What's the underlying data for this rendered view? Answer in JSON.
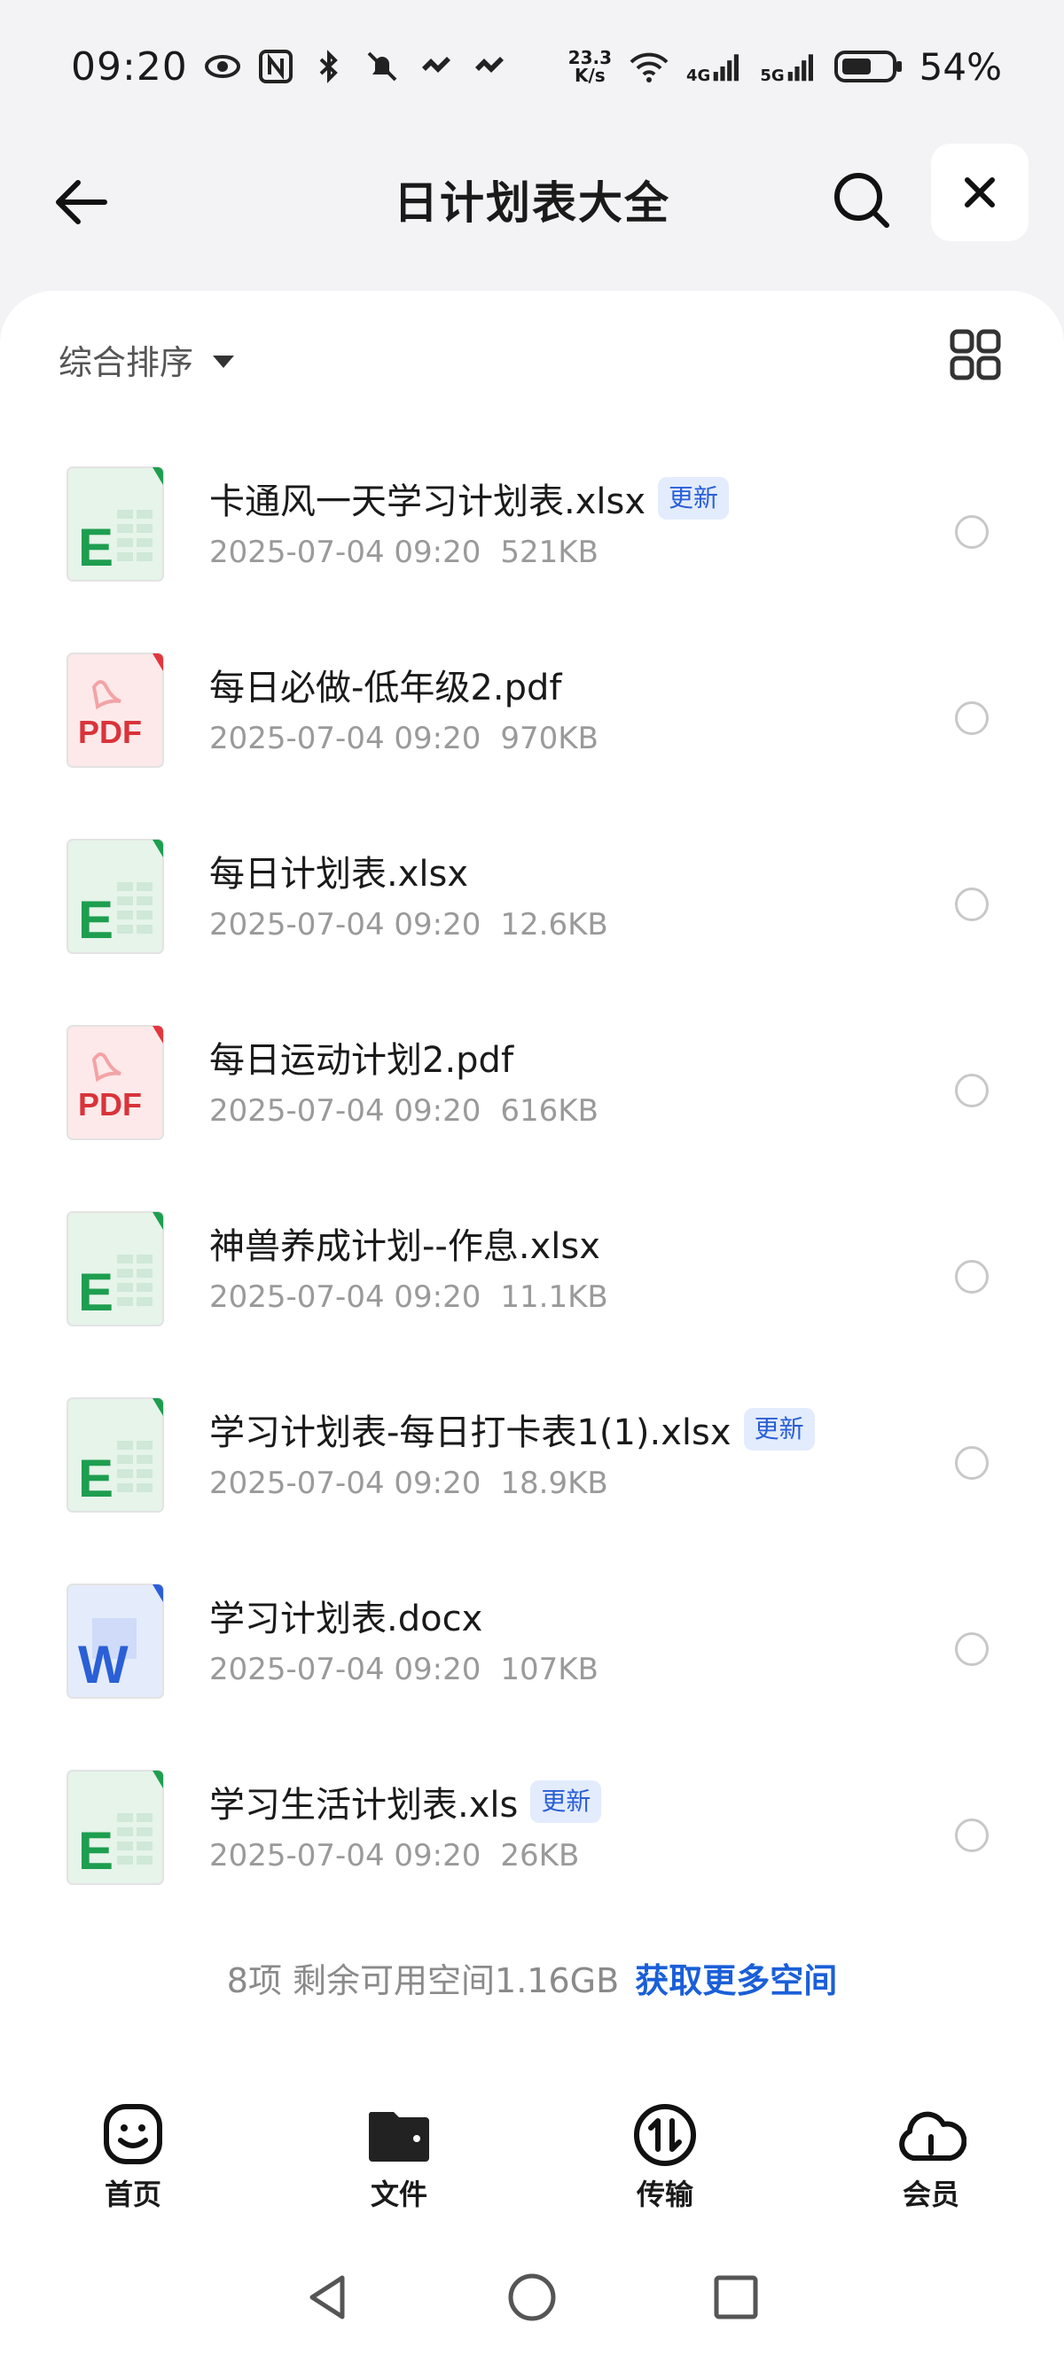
{
  "status_bar": {
    "time": "09:20",
    "net_speed_value": "23.3",
    "net_speed_unit": "K/s",
    "net_4g": "4G",
    "net_5g": "5G",
    "battery_percent": "54%"
  },
  "header": {
    "title": "日计划表大全",
    "back_icon": "arrow-left-icon",
    "search_icon": "search-icon",
    "close_icon": "close-icon"
  },
  "toolbar": {
    "sort_label": "综合排序",
    "view_icon": "grid-view-icon"
  },
  "files": [
    {
      "name": "卡通风一天学习计划表.xlsx",
      "type": "excel",
      "badge": "更新",
      "date": "2025-07-04 09:20",
      "size": "521KB"
    },
    {
      "name": "每日必做-低年级2.pdf",
      "type": "pdf",
      "badge": "",
      "date": "2025-07-04 09:20",
      "size": "970KB"
    },
    {
      "name": "每日计划表.xlsx",
      "type": "excel",
      "badge": "",
      "date": "2025-07-04 09:20",
      "size": "12.6KB"
    },
    {
      "name": "每日运动计划2.pdf",
      "type": "pdf",
      "badge": "",
      "date": "2025-07-04 09:20",
      "size": "616KB"
    },
    {
      "name": "神兽养成计划--作息.xlsx",
      "type": "excel",
      "badge": "",
      "date": "2025-07-04 09:20",
      "size": "11.1KB"
    },
    {
      "name": "学习计划表-每日打卡表1(1).xlsx",
      "type": "excel",
      "badge": "更新",
      "date": "2025-07-04 09:20",
      "size": "18.9KB"
    },
    {
      "name": "学习计划表.docx",
      "type": "word",
      "badge": "",
      "date": "2025-07-04 09:20",
      "size": "107KB"
    },
    {
      "name": "学习生活计划表.xls",
      "type": "excel",
      "badge": "更新",
      "date": "2025-07-04 09:20",
      "size": "26KB"
    }
  ],
  "file_icon_text": {
    "excel": "E",
    "pdf": "PDF",
    "word": "W"
  },
  "footer": {
    "summary": "8项 剩余可用空间1.16GB",
    "more_space_link": "获取更多空间"
  },
  "bottom_nav": [
    {
      "label": "首页",
      "icon": "home-smile-icon"
    },
    {
      "label": "文件",
      "icon": "folder-icon"
    },
    {
      "label": "传输",
      "icon": "transfer-icon"
    },
    {
      "label": "会员",
      "icon": "cloud-icon"
    }
  ],
  "colors": {
    "accent_blue": "#1a5fd8",
    "badge_bg": "#e3ecfd",
    "excel_green": "#1e9e4f",
    "pdf_red": "#e0383e",
    "word_blue": "#2a5fd6"
  }
}
